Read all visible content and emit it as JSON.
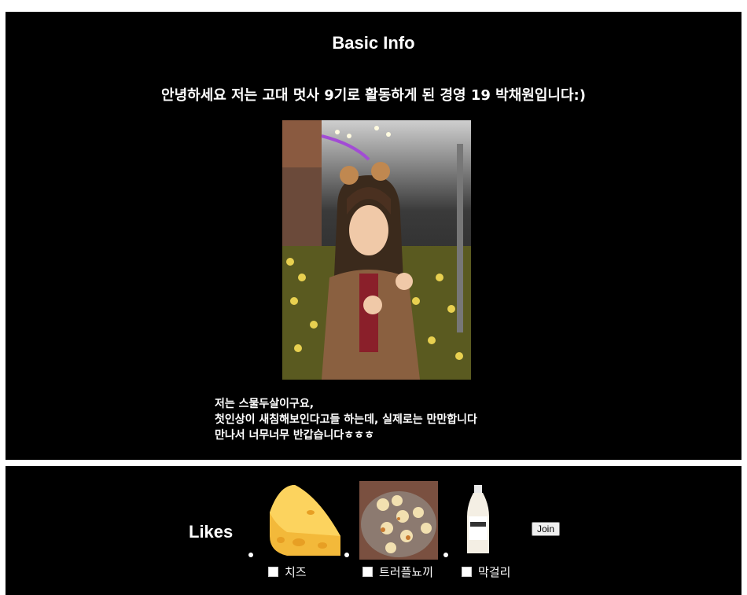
{
  "info": {
    "title": "Basic Info",
    "greeting": "안녕하세요 저는 고대 멋사 9기로 활동하게 된 경영 19 박채원입니다:)",
    "bio_lines": [
      "저는 스물두살이구요,",
      "첫인상이 새침해보인다고들 하는데, 실제로는 만만합니다",
      "만나서 너무너무 반갑습니다ㅎㅎㅎ"
    ]
  },
  "likes": {
    "label": "Likes",
    "items": [
      {
        "label": "치즈",
        "icon": "cheese-image"
      },
      {
        "label": "트러플뇨끼",
        "icon": "truffle-gnocchi-image"
      },
      {
        "label": "막걸리",
        "icon": "makgeolli-bottle-image"
      }
    ],
    "join_label": "Join"
  },
  "colors": {
    "background": "#000000",
    "border": "#ffffff",
    "text": "#ffffff"
  }
}
